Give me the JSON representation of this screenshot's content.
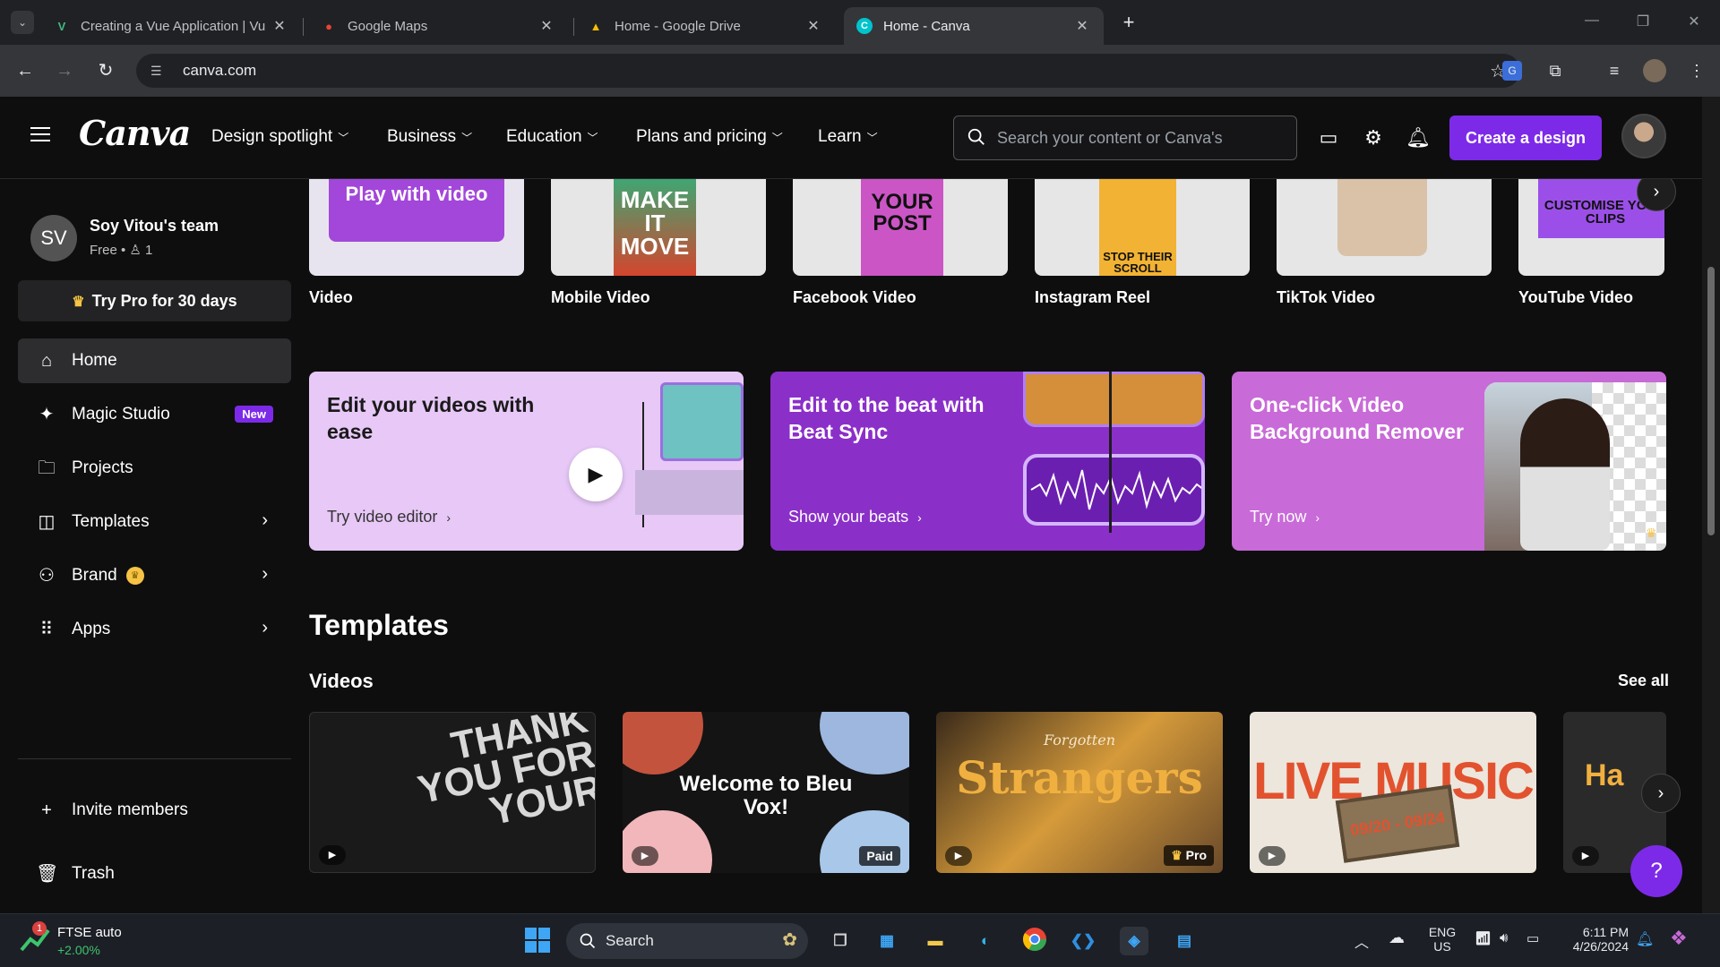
{
  "browser": {
    "tabs": [
      {
        "title": "Creating a Vue Application | Vu",
        "favicon": "vue-logo",
        "color": "#42b883"
      },
      {
        "title": "Google Maps",
        "favicon": "maps-pin",
        "color": "#ea4335"
      },
      {
        "title": "Home - Google Drive",
        "favicon": "drive-logo",
        "color": "#fbbc04"
      },
      {
        "title": "Home - Canva",
        "favicon": "canva-logo",
        "color": "#00c4cc"
      }
    ],
    "url": "canva.com"
  },
  "header": {
    "logo": "Canva",
    "nav": [
      "Design spotlight",
      "Business",
      "Education",
      "Plans and pricing",
      "Learn"
    ],
    "search_placeholder": "Search your content or Canva's",
    "create_label": "Create a design"
  },
  "sidebar": {
    "team_initials": "SV",
    "team_name": "Soy Vitou's team",
    "team_sub": "Free • ♙ 1",
    "try_pro": "Try Pro for 30 days",
    "items": [
      {
        "label": "Home",
        "icon": "home-icon"
      },
      {
        "label": "Magic Studio",
        "icon": "sparkle-icon",
        "badge": "New"
      },
      {
        "label": "Projects",
        "icon": "folder-icon"
      },
      {
        "label": "Templates",
        "icon": "templates-icon"
      },
      {
        "label": "Brand",
        "icon": "brand-icon"
      },
      {
        "label": "Apps",
        "icon": "apps-icon"
      }
    ],
    "invite": "Invite members",
    "trash": "Trash"
  },
  "video_types": [
    {
      "label": "Video",
      "thumb": "Play with video"
    },
    {
      "label": "Mobile Video",
      "thumb": "MAKE IT MOVE"
    },
    {
      "label": "Facebook Video",
      "thumb": "YOUR POST"
    },
    {
      "label": "Instagram Reel",
      "thumb": "STOP THEIR SCROLL"
    },
    {
      "label": "TikTok Video",
      "thumb": ""
    },
    {
      "label": "YouTube Video",
      "thumb": "CUSTOMISE YOUR CLIPS"
    }
  ],
  "promos": [
    {
      "title": "Edit your videos with ease",
      "link": "Try video editor",
      "bg": "#e7c8f7",
      "fg": "#1a1a1a"
    },
    {
      "title": "Edit to the beat with Beat Sync",
      "link": "Show your beats",
      "bg": "#8b2fc9",
      "fg": "#ffffff"
    },
    {
      "title": "One-click Video Background Remover",
      "link": "Try now",
      "bg": "#c86ad8",
      "fg": "#ffffff"
    }
  ],
  "templates": {
    "heading": "Templates",
    "subheading": "Videos",
    "see_all": "See all",
    "items": [
      {
        "text": "THANK YOU FOR YOUR",
        "badge": ""
      },
      {
        "text": "Welcome to Bleu Vox!",
        "badge": "Paid"
      },
      {
        "text": "Strangers",
        "subtitle": "Forgotten",
        "badge": "Pro"
      },
      {
        "text": "LIVE MUSIC",
        "subtitle": "09/20 - 09/24",
        "badge": ""
      },
      {
        "text": "Ha",
        "badge": ""
      }
    ]
  },
  "taskbar": {
    "widget_title": "FTSE auto",
    "widget_value": "+2.00%",
    "widget_badge": "1",
    "search": "Search",
    "lang_top": "ENG",
    "lang_bottom": "US",
    "time": "6:11 PM",
    "date": "4/26/2024"
  }
}
